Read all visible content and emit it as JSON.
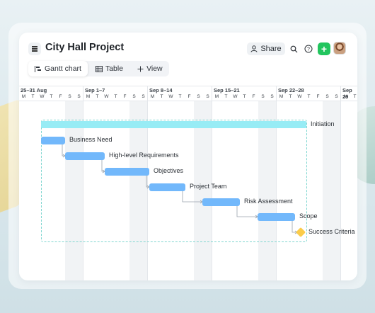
{
  "header": {
    "title": "City Hall Project",
    "share_label": "Share",
    "menu_icon": "menu-icon",
    "add_label": "+"
  },
  "view_tabs": [
    {
      "label": "Gantt chart",
      "icon": "gantt-icon",
      "active": true
    },
    {
      "label": "Table",
      "icon": "table-icon",
      "active": false
    },
    {
      "label": "View",
      "icon": "plus-icon",
      "active": false
    }
  ],
  "timeline": {
    "weeks": [
      "25–31 Aug",
      "Sep 1–7",
      "Sep 8–14",
      "Sep 15–21",
      "Sep 22–28",
      "Sep 29"
    ],
    "day_letters": [
      "M",
      "T",
      "W",
      "T",
      "F",
      "S",
      "S"
    ]
  },
  "tasks": [
    {
      "name": "Initiation",
      "type": "summary"
    },
    {
      "name": "Business Need",
      "type": "task"
    },
    {
      "name": "High-level Requirements",
      "type": "task"
    },
    {
      "name": "Objectives",
      "type": "task"
    },
    {
      "name": "Project Team",
      "type": "task"
    },
    {
      "name": "Risk Assessment",
      "type": "task"
    },
    {
      "name": "Scope",
      "type": "task"
    },
    {
      "name": "Success Criteria",
      "type": "milestone"
    }
  ],
  "colors": {
    "task_bar": "#72b8fb",
    "summary_bar": "#97ecf5",
    "milestone": "#fbcc4a",
    "add_button": "#22c55e",
    "selection_border": "#7fd6d0"
  }
}
